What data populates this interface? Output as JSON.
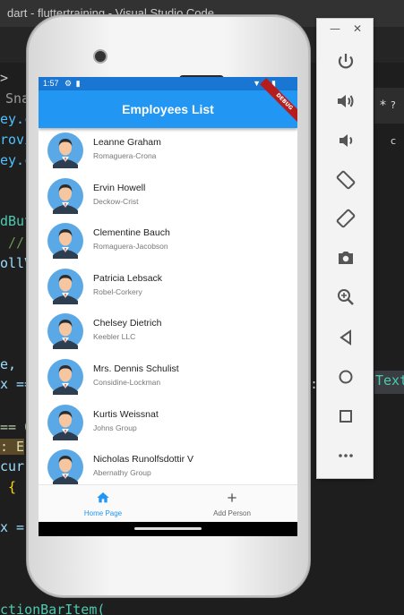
{
  "window_title": "dart - fluttertraining - Visual Studio Code",
  "code_fragments": [
    {
      "text": "> ",
      "color": "#cccccc"
    },
    {
      "text": "Sna",
      "color": "#9a9a9a"
    },
    {
      "text": "ey.c",
      "color": "#4fc1ff"
    },
    {
      "text": "rovi",
      "color": "#4fc1ff"
    },
    {
      "text": "ey.c",
      "color": "#4fc1ff"
    },
    {
      "text": "dBut",
      "color": "#4ec9b0"
    },
    {
      "text": " //",
      "color": "#6a9955"
    },
    {
      "text": "ollV",
      "color": "#9cdcfe"
    },
    {
      "text": "e,",
      "color": "#9cdcfe"
    },
    {
      "text": "x ==",
      "color": "#9cdcfe"
    },
    {
      "text": "== 0",
      "color": "#b5cea8"
    },
    {
      "text": ": E",
      "color": "#dcdcaa"
    },
    {
      "text": "curr",
      "color": "#9cdcfe"
    },
    {
      "text": " {",
      "color": "#ffd700"
    },
    {
      "text": "x =",
      "color": "#9cdcfe"
    },
    {
      "text": "ctionBarItem(",
      "color": "#4ec9b0"
    }
  ],
  "right_fragments": {
    "text_label": "Text",
    "colon": ":",
    "question": "? c"
  },
  "status": {
    "time": "1:57"
  },
  "app": {
    "title": "Employees List",
    "debug_label": "DEBUG",
    "colors": {
      "primary": "#2196f3",
      "status": "#1976d2",
      "accent": "#2196f3"
    }
  },
  "employees": [
    {
      "name": "Leanne Graham",
      "company": "Romaguera-Crona"
    },
    {
      "name": "Ervin Howell",
      "company": "Deckow-Crist"
    },
    {
      "name": "Clementine Bauch",
      "company": "Romaguera-Jacobson"
    },
    {
      "name": "Patricia Lebsack",
      "company": "Robel-Corkery"
    },
    {
      "name": "Chelsey Dietrich",
      "company": "Keebler LLC"
    },
    {
      "name": "Mrs. Dennis Schulist",
      "company": "Considine-Lockman"
    },
    {
      "name": "Kurtis Weissnat",
      "company": "Johns Group"
    },
    {
      "name": "Nicholas Runolfsdottir V",
      "company": "Abernathy Group"
    }
  ],
  "bottom_nav": [
    {
      "label": "Home Page",
      "icon": "home-icon",
      "active": true
    },
    {
      "label": "Add Person",
      "icon": "add-icon",
      "active": false
    }
  ],
  "emulator_controls": [
    "power-icon",
    "volume-up-icon",
    "volume-down-icon",
    "rotate-left-icon",
    "rotate-right-icon",
    "camera-icon",
    "zoom-icon",
    "back-icon",
    "home-circle-icon",
    "overview-icon",
    "more-icon"
  ]
}
